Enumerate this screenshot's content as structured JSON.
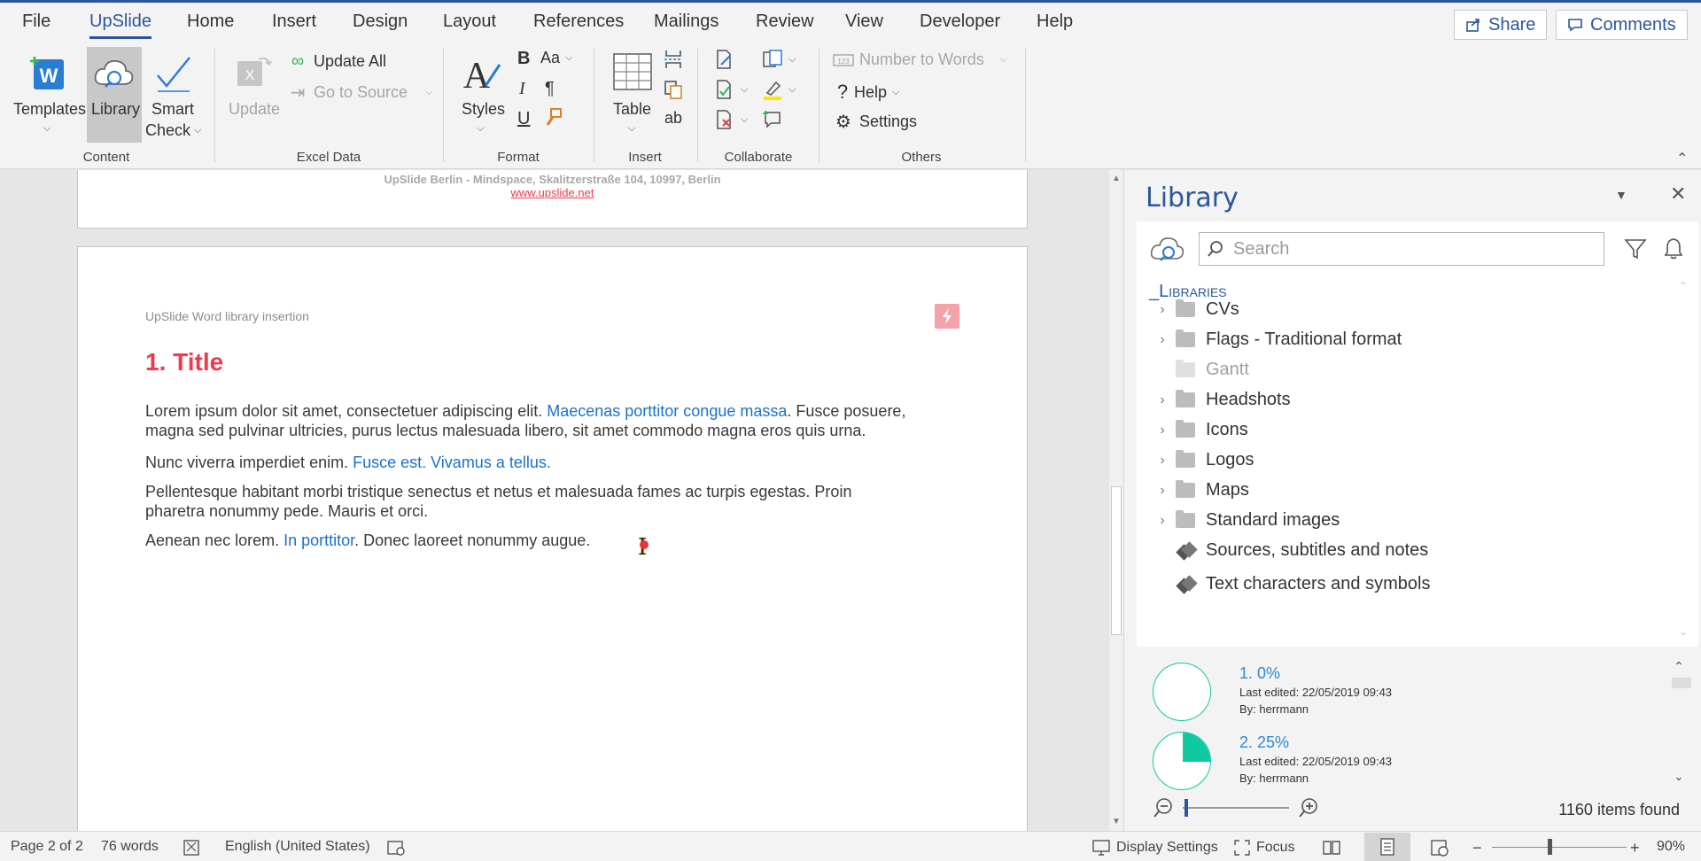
{
  "tabs": [
    "File",
    "UpSlide",
    "Home",
    "Insert",
    "Design",
    "Layout",
    "References",
    "Mailings",
    "Review",
    "View",
    "Developer",
    "Help"
  ],
  "header": {
    "share": "Share",
    "comments": "Comments"
  },
  "ribbon": {
    "content": {
      "templates": "Templates",
      "library": "Library",
      "smart": "Smart",
      "check": "Check",
      "label": "Content"
    },
    "excel": {
      "update": "Update",
      "update_all": "Update All",
      "go_to_source": "Go to Source",
      "label": "Excel Data"
    },
    "format": {
      "bold": "B",
      "italic": "I",
      "underline": "U",
      "font_size": "Aa",
      "pilcrow": "¶",
      "styles": "Styles",
      "label": "Format"
    },
    "insert": {
      "table": "Table",
      "ab": "ab",
      "label": "Insert"
    },
    "collaborate": {
      "label": "Collaborate"
    },
    "others": {
      "number_to_words": "Number to Words",
      "help": "Help",
      "settings": "Settings",
      "label": "Others"
    }
  },
  "document": {
    "footer_address": "UpSlide Berlin - Mindspace, Skalitzerstraße 104, 10997, Berlin",
    "footer_url": "www.upslide.net",
    "header_text": "UpSlide Word library insertion",
    "title": "1. Title",
    "p1_a": "Lorem ipsum dolor sit amet, consectetuer adipiscing elit. ",
    "p1_link": "Maecenas porttitor congue massa",
    "p1_b": ". Fusce posuere,",
    "p1_c": "magna sed pulvinar ultricies, purus lectus malesuada libero, sit amet commodo magna eros quis urna.",
    "p2_a": "Nunc viverra imperdiet enim. ",
    "p2_link": "Fusce est. Vivamus a tellus.",
    "p3_a": "Pellentesque habitant morbi tristique senectus et netus et malesuada fames ac turpis egestas. Proin",
    "p3_b": "pharetra nonummy pede. Mauris et orci.",
    "p4_a": "Aenean nec lorem. ",
    "p4_link": "In porttitor",
    "p4_b": ". Donec laoreet nonummy augue."
  },
  "library": {
    "title": "Library",
    "search_placeholder": "Search",
    "root": "_Libraries",
    "folders": [
      {
        "label": "CVs",
        "expandable": true,
        "enabled": true,
        "kind": "folder"
      },
      {
        "label": "Flags - Traditional format",
        "expandable": true,
        "enabled": true,
        "kind": "folder"
      },
      {
        "label": "Gantt",
        "expandable": false,
        "enabled": false,
        "kind": "folder"
      },
      {
        "label": "Headshots",
        "expandable": true,
        "enabled": true,
        "kind": "folder"
      },
      {
        "label": "Icons",
        "expandable": true,
        "enabled": true,
        "kind": "folder"
      },
      {
        "label": "Logos",
        "expandable": true,
        "enabled": true,
        "kind": "folder"
      },
      {
        "label": "Maps",
        "expandable": true,
        "enabled": true,
        "kind": "folder"
      },
      {
        "label": "Standard images",
        "expandable": true,
        "enabled": true,
        "kind": "folder"
      },
      {
        "label": "Sources, subtitles and notes",
        "expandable": false,
        "enabled": true,
        "kind": "stack"
      },
      {
        "label": "Text characters and symbols",
        "expandable": false,
        "enabled": true,
        "kind": "stack"
      }
    ],
    "results": [
      {
        "title": "1. 0%",
        "edited": "Last edited: 22/05/2019 09:43",
        "by": "By: herrmann",
        "fill": 0
      },
      {
        "title": "2. 25%",
        "edited": "Last edited: 22/05/2019 09:43",
        "by": "By: herrmann",
        "fill": 0.25
      }
    ],
    "items_found": "1160 items found",
    "accent": "#10c9a0"
  },
  "status": {
    "page": "Page 2 of 2",
    "words": "76 words",
    "language": "English (United States)",
    "display_settings": "Display Settings",
    "focus": "Focus",
    "zoom": "90%"
  },
  "colors": {
    "brand": "#2b579a",
    "title_red": "#f0394a",
    "link": "#1a73c8"
  }
}
